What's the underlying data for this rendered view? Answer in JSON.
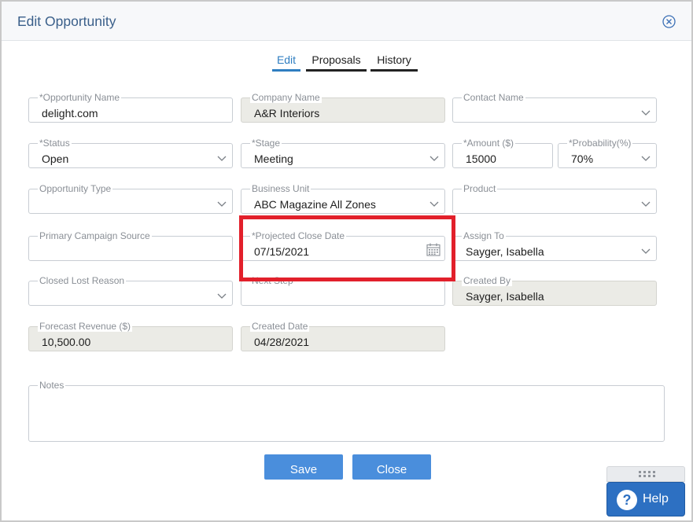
{
  "modal": {
    "title": "Edit Opportunity"
  },
  "tabs": [
    {
      "label": "Edit",
      "active": true
    },
    {
      "label": "Proposals",
      "active": false
    },
    {
      "label": "History",
      "active": false
    }
  ],
  "fields": {
    "opportunity_name": {
      "label": "*Opportunity Name",
      "value": "delight.com"
    },
    "company_name": {
      "label": "Company Name",
      "value": "A&R Interiors"
    },
    "contact_name": {
      "label": "Contact Name",
      "value": ""
    },
    "status": {
      "label": "*Status",
      "value": "Open"
    },
    "stage": {
      "label": "*Stage",
      "value": "Meeting"
    },
    "amount": {
      "label": "*Amount ($)",
      "value": "15000"
    },
    "probability": {
      "label": "*Probability(%)",
      "value": "70%"
    },
    "opportunity_type": {
      "label": "Opportunity Type",
      "value": ""
    },
    "business_unit": {
      "label": "Business Unit",
      "value": "ABC Magazine All Zones"
    },
    "product": {
      "label": "Product",
      "value": ""
    },
    "primary_campaign_source": {
      "label": "Primary Campaign Source",
      "value": ""
    },
    "projected_close_date": {
      "label": "*Projected Close Date",
      "value": "07/15/2021"
    },
    "assign_to": {
      "label": "Assign To",
      "value": "Sayger, Isabella"
    },
    "closed_lost_reason": {
      "label": "Closed Lost Reason",
      "value": ""
    },
    "next_step": {
      "label": "Next Step",
      "value": ""
    },
    "created_by": {
      "label": "Created By",
      "value": "Sayger, Isabella"
    },
    "forecast_revenue": {
      "label": "Forecast Revenue ($)",
      "value": "10,500.00"
    },
    "created_date": {
      "label": "Created Date",
      "value": "04/28/2021"
    },
    "notes": {
      "label": "Notes",
      "value": ""
    }
  },
  "buttons": {
    "save": "Save",
    "close": "Close"
  },
  "help": {
    "icon": "?",
    "label": "Help"
  },
  "colors": {
    "accent": "#2f7ec1",
    "button": "#4a8edc",
    "help": "#2d70c2",
    "highlight": "#e2202b"
  }
}
